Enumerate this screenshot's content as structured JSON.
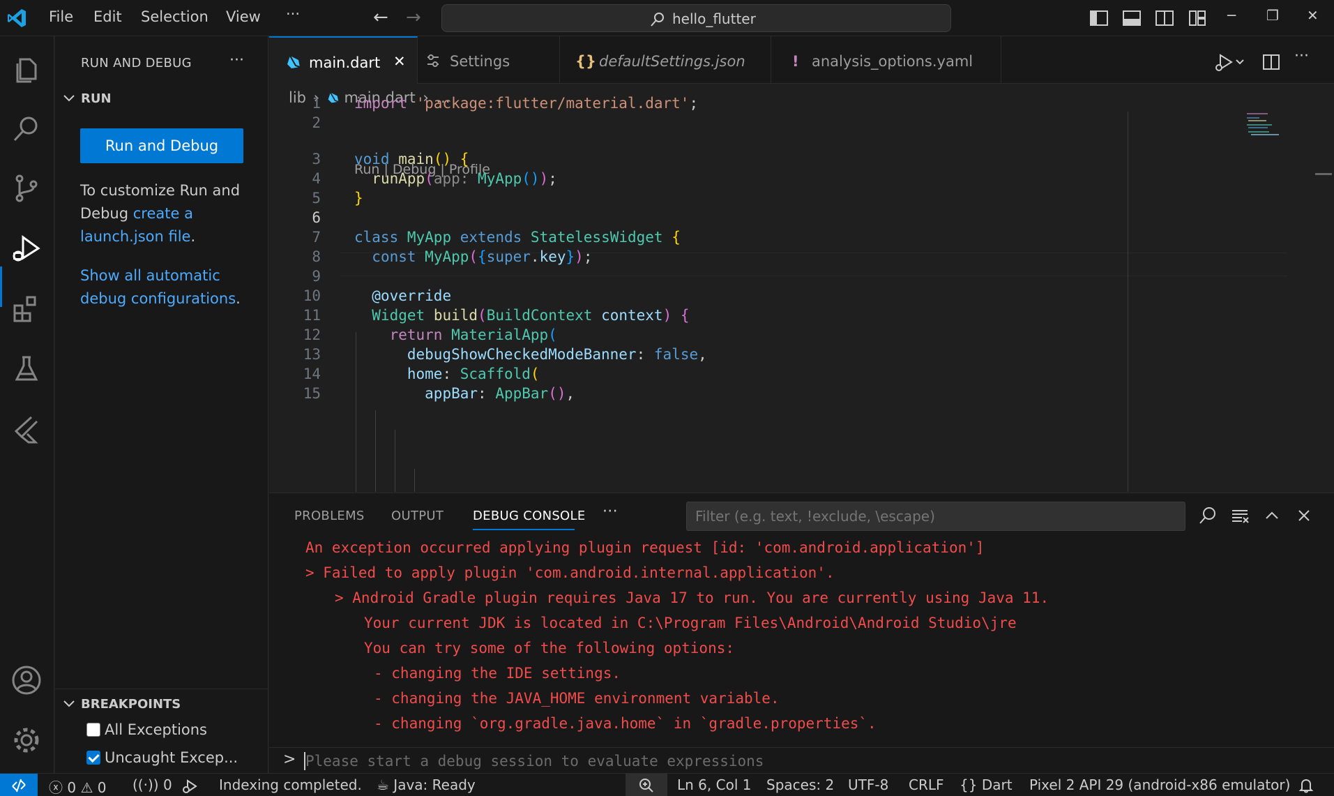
{
  "titlebar": {
    "menu": [
      "File",
      "Edit",
      "Selection",
      "View"
    ],
    "more": "···",
    "search_text": "hello_flutter"
  },
  "sidebar": {
    "title": "RUN AND DEBUG",
    "more": "···",
    "run_section": "RUN",
    "run_button": "Run and Debug",
    "customize_text": "To customize Run and Debug ",
    "customize_link": "create a launch.json file",
    "customize_end": ".",
    "show_link": "Show all automatic debug configurations",
    "show_end": ".",
    "breakpoints_section": "BREAKPOINTS",
    "breakpoints": [
      {
        "label": "All Exceptions",
        "checked": false
      },
      {
        "label": "Uncaught Excep...",
        "checked": true
      }
    ]
  },
  "tabs": [
    {
      "label": "main.dart",
      "active": true,
      "close": "✕"
    },
    {
      "label": "Settings",
      "active": false
    },
    {
      "label": "defaultSettings.json",
      "active": false,
      "icon_text": "{}"
    },
    {
      "label": "analysis_options.yaml",
      "active": false,
      "icon_text": "!"
    }
  ],
  "breadcrumb": {
    "folder": "lib",
    "file": "main.dart",
    "rest": "..."
  },
  "editor": {
    "codelens": "Run | Debug | Profile",
    "line_numbers": [
      "1",
      "2",
      "3",
      "4",
      "5",
      "6",
      "7",
      "8",
      "9",
      "10",
      "11",
      "12",
      "13",
      "14",
      "15"
    ],
    "current_line": "6"
  },
  "panel": {
    "tabs": [
      "PROBLEMS",
      "OUTPUT",
      "DEBUG CONSOLE"
    ],
    "more": "···",
    "filter_placeholder": "Filter (e.g. text, !exclude, \\escape)",
    "console_lines": [
      "An exception occurred applying plugin request [id: 'com.android.application']",
      "> Failed to apply plugin 'com.android.internal.application'.",
      "> Android Gradle plugin requires Java 17 to run. You are currently using Java 11.",
      "Your current JDK is located in C:\\Program Files\\Android\\Android Studio\\jre",
      "You can try some of the following options:",
      "- changing the IDE settings.",
      "- changing the JAVA_HOME environment variable.",
      "- changing `org.gradle.java.home` in `gradle.properties`."
    ],
    "prompt": ">",
    "input_placeholder": "Please start a debug session to evaluate expressions"
  },
  "statusbar": {
    "errors": "0",
    "warnings": "0",
    "ports": "0",
    "indexing": "Indexing completed.",
    "java": "Java: Ready",
    "position": "Ln 6, Col 1",
    "spaces": "Spaces: 2",
    "encoding": "UTF-8",
    "eol": "CRLF",
    "language_icon": "{}",
    "language": "Dart",
    "device": "Pixel 2 API 29 (android-x86 emulator)"
  },
  "colors": {
    "accent": "#0078d4",
    "error_text": "#f14c4c",
    "link": "#4daafc"
  }
}
